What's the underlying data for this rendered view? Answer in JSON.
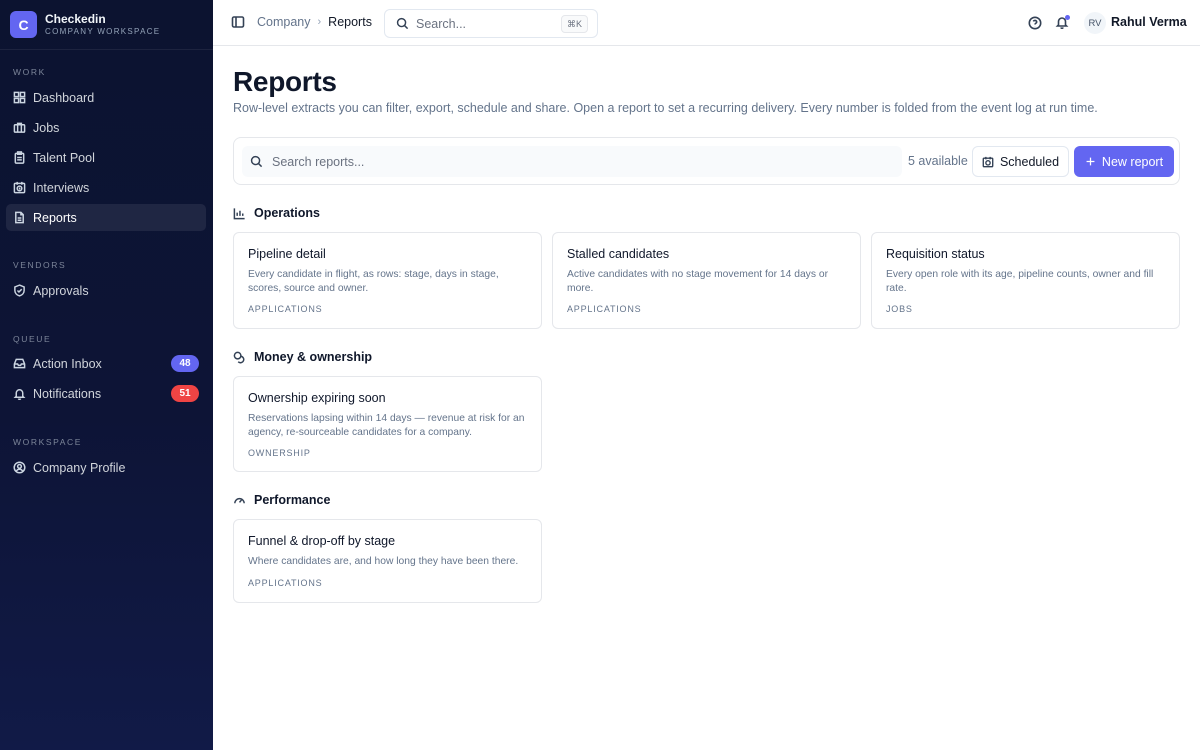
{
  "brand": {
    "initial": "C",
    "name": "Checkedin",
    "subtitle": "COMPANY WORKSPACE"
  },
  "sidebar": {
    "sections": [
      {
        "label": "WORK"
      },
      {
        "label": "VENDORS"
      },
      {
        "label": "QUEUE"
      },
      {
        "label": "WORKSPACE"
      }
    ],
    "items": [
      {
        "label": "Dashboard",
        "icon": "grid-icon"
      },
      {
        "label": "Jobs",
        "icon": "briefcase-icon"
      },
      {
        "label": "Talent Pool",
        "icon": "clipboard-icon"
      },
      {
        "label": "Interviews",
        "icon": "calendar-clock-icon"
      },
      {
        "label": "Reports",
        "icon": "file-icon",
        "active": true
      },
      {
        "label": "Approvals",
        "icon": "shield-check-icon"
      },
      {
        "label": "Action Inbox",
        "icon": "inbox-icon",
        "badge": "48"
      },
      {
        "label": "Notifications",
        "icon": "bell-icon",
        "badge": "51"
      },
      {
        "label": "Company Profile",
        "icon": "user-circle-icon"
      }
    ]
  },
  "topbar": {
    "breadcrumb": [
      "Company",
      "Reports"
    ],
    "search_placeholder": "Search...",
    "shortcut": "⌘K",
    "user_initials": "RV",
    "user_name": "Rahul Verma"
  },
  "page": {
    "title": "Reports",
    "description": "Row-level extracts you can filter, export, schedule and share. Open a report to set a recurring delivery. Every number is folded from the event log at run time.",
    "search_placeholder": "Search reports...",
    "available": "5 available",
    "scheduled_label": "Scheduled",
    "new_report_label": "New report"
  },
  "sections": [
    {
      "title": "Operations",
      "cards": [
        {
          "title": "Pipeline detail",
          "description": "Every candidate in flight, as rows: stage, days in stage, scores, source and owner.",
          "tag": "APPLICATIONS"
        },
        {
          "title": "Stalled candidates",
          "description": "Active candidates with no stage movement for 14 days or more.",
          "tag": "APPLICATIONS"
        },
        {
          "title": "Requisition status",
          "description": "Every open role with its age, pipeline counts, owner and fill rate.",
          "tag": "JOBS"
        }
      ]
    },
    {
      "title": "Money & ownership",
      "cards": [
        {
          "title": "Ownership expiring soon",
          "description": "Reservations lapsing within 14 days — revenue at risk for an agency, re-sourceable candidates for a company.",
          "tag": "OWNERSHIP"
        }
      ]
    },
    {
      "title": "Performance",
      "cards": [
        {
          "title": "Funnel & drop-off by stage",
          "description": "Where candidates are, and how long they have been there.",
          "tag": "APPLICATIONS"
        }
      ]
    }
  ],
  "colors": {
    "accent": "#6366f1",
    "danger": "#ef4444",
    "sidebar_bg": "#0c1330"
  }
}
